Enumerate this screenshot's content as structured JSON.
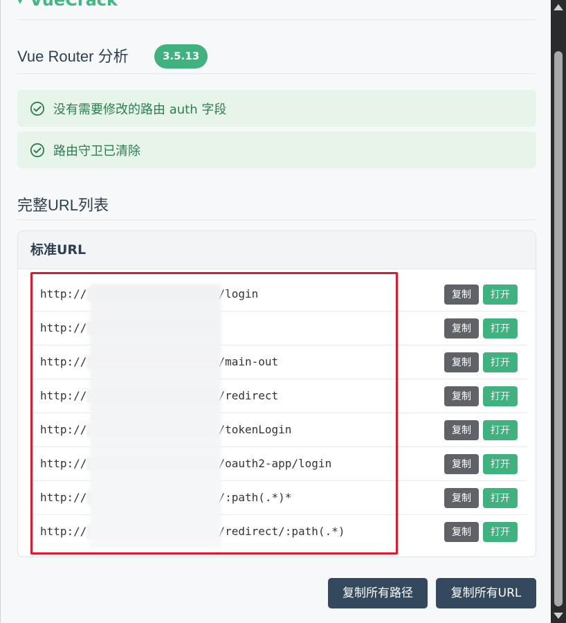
{
  "top": {
    "cut_title": "VueCrack",
    "chevron": "▾"
  },
  "router_section": {
    "title": "Vue Router 分析",
    "version": "3.5.13"
  },
  "alerts": [
    {
      "text": "没有需要修改的路由 auth 字段",
      "icon": "check-circle-icon"
    },
    {
      "text": "路由守卫已清除",
      "icon": "check-circle-icon"
    }
  ],
  "url_section": {
    "title": "完整URL列表"
  },
  "card": {
    "header": "标准URL",
    "rows": [
      {
        "prefix": "http://",
        "path": "/login"
      },
      {
        "prefix": "http://",
        "path": ""
      },
      {
        "prefix": "http://",
        "path": "/main-out"
      },
      {
        "prefix": "http://",
        "path": "/redirect"
      },
      {
        "prefix": "http://",
        "path": "/tokenLogin"
      },
      {
        "prefix": "http://",
        "path": "/oauth2-app/login"
      },
      {
        "prefix": "http://",
        "path": "/:path(.*)*"
      },
      {
        "prefix": "http://",
        "path": "/redirect/:path(.*)"
      }
    ],
    "copy_label": "复制",
    "open_label": "打开"
  },
  "actions": {
    "copy_paths": "复制所有路径",
    "copy_urls": "复制所有URL"
  },
  "colors": {
    "accent": "#42b883",
    "success_bg": "#e6f4ea",
    "dark_button": "#34495e",
    "highlight": "#e0192b"
  }
}
